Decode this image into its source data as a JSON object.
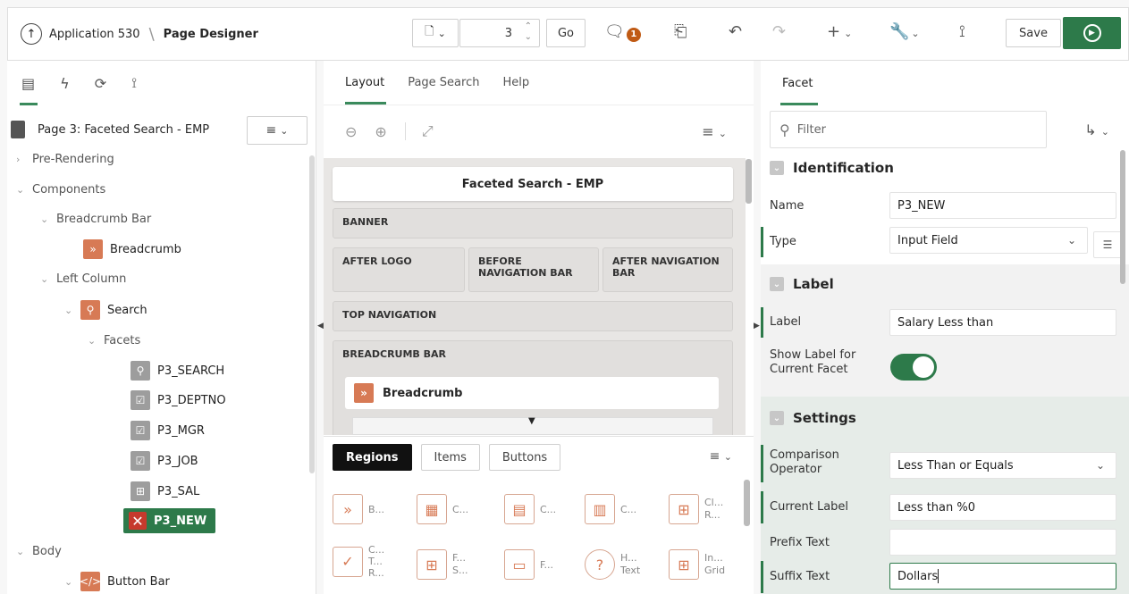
{
  "header": {
    "app_name": "Application 530",
    "page_designer": "Page Designer",
    "page_number": "3",
    "go_label": "Go",
    "messages_count": "1",
    "save_label": "Save"
  },
  "left": {
    "page_title": "Page 3: Faceted Search - EMP",
    "tree": {
      "pre_rendering": "Pre-Rendering",
      "components": "Components",
      "breadcrumb_bar": "Breadcrumb Bar",
      "breadcrumb": "Breadcrumb",
      "left_column": "Left Column",
      "search": "Search",
      "facets": "Facets",
      "p3_search": "P3_SEARCH",
      "p3_deptno": "P3_DEPTNO",
      "p3_mgr": "P3_MGR",
      "p3_job": "P3_JOB",
      "p3_sal": "P3_SAL",
      "p3_new": "P3_NEW",
      "body": "Body",
      "button_bar": "Button Bar"
    }
  },
  "middle": {
    "tabs": [
      "Layout",
      "Page Search",
      "Help"
    ],
    "canvas": {
      "title": "Faceted Search - EMP",
      "banner": "BANNER",
      "after_logo": "AFTER LOGO",
      "before_nav": "BEFORE NAVIGATION BAR",
      "after_nav": "AFTER NAVIGATION BAR",
      "top_nav": "TOP NAVIGATION",
      "breadcrumb_bar": "BREADCRUMB BAR",
      "breadcrumb": "Breadcrumb"
    },
    "gallery_tabs": [
      "Regions",
      "Items",
      "Buttons"
    ],
    "gallery_items": [
      {
        "label": "B..."
      },
      {
        "label": "C..."
      },
      {
        "label": "C..."
      },
      {
        "label": "C..."
      },
      {
        "label": "Cl... R..."
      },
      {
        "label": "C... T... R..."
      },
      {
        "label": "F... S..."
      },
      {
        "label": "F..."
      },
      {
        "label": "H... Text"
      },
      {
        "label": "In... Grid"
      }
    ]
  },
  "right": {
    "tab": "Facet",
    "filter_placeholder": "Filter",
    "identification": "Identification",
    "name_label": "Name",
    "name_value": "P3_NEW",
    "type_label": "Type",
    "type_value": "Input Field",
    "label_section": "Label",
    "label_label": "Label",
    "label_value": "Salary Less than",
    "show_label": "Show Label for Current Facet",
    "settings": "Settings",
    "comparison_label": "Comparison Operator",
    "comparison_value": "Less Than or Equals",
    "current_label_label": "Current Label",
    "current_label_value": "Less than %0",
    "prefix_label": "Prefix Text",
    "prefix_value": "",
    "suffix_label": "Suffix Text",
    "suffix_value": "Dollars"
  }
}
